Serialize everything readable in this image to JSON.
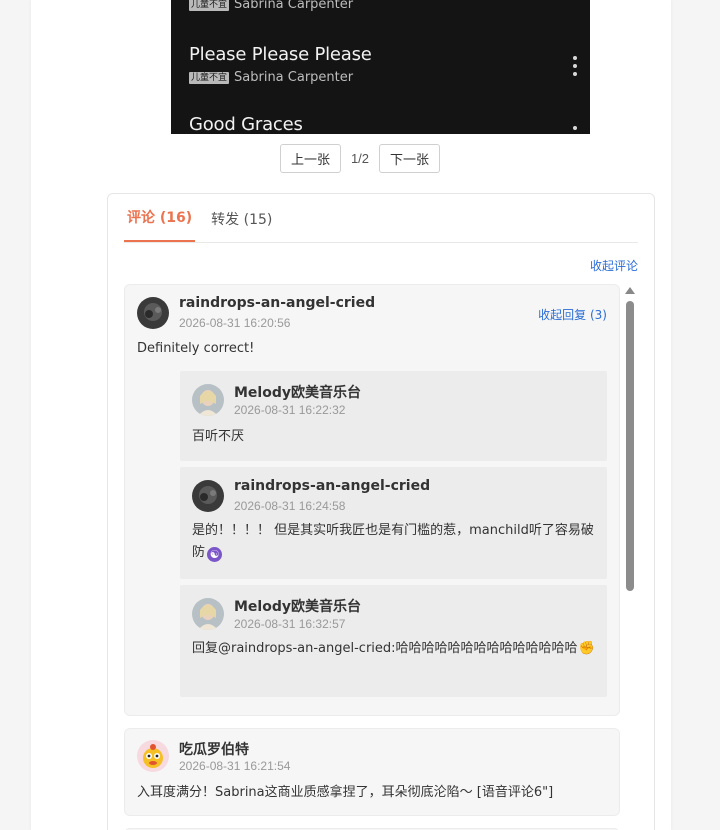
{
  "music": {
    "songs": [
      {
        "title": "",
        "tag": "儿童不宜",
        "artist": "Sabrina Carpenter"
      },
      {
        "title": "Please Please Please",
        "tag": "儿童不宜",
        "artist": "Sabrina Carpenter"
      },
      {
        "title": "Good Graces",
        "tag": "",
        "artist": ""
      }
    ]
  },
  "pager": {
    "prev_label": "上一张",
    "count": "1/2",
    "next_label": "下一张"
  },
  "tabs": {
    "comments_label": "评论 (16)",
    "reposts_label": "转发 (15)"
  },
  "collapse_comments_label": "收起评论",
  "comments": [
    {
      "user": "raindrops-an-angel-cried",
      "time": "2026-08-31 16:20:56",
      "text": "Definitely correct!",
      "fold_label": "收起回复 (3)",
      "replies": [
        {
          "user": "Melody欧美音乐台",
          "time": "2026-08-31 16:22:32",
          "text": "百听不厌"
        },
        {
          "user": "raindrops-an-angel-cried",
          "time": "2026-08-31 16:24:58",
          "text": "是的！！！！ 但是其实听我匠也是有门槛的惹，manchild听了容易破防",
          "emoji": "☯"
        },
        {
          "user": "Melody欧美音乐台",
          "time": "2026-08-31 16:32:57",
          "text": "回复@raindrops-an-angel-cried:哈哈哈哈哈哈哈哈哈哈哈哈哈哈",
          "emoji": "✊"
        }
      ]
    },
    {
      "user": "吃瓜罗伯特",
      "time": "2026-08-31 16:21:54",
      "text": "入耳度满分！Sabrina这商业质感拿捏了，耳朵彻底沦陷～ [语音评论6\"]"
    }
  ],
  "colors": {
    "accent": "#eb7350",
    "link": "#2a6dd5"
  }
}
